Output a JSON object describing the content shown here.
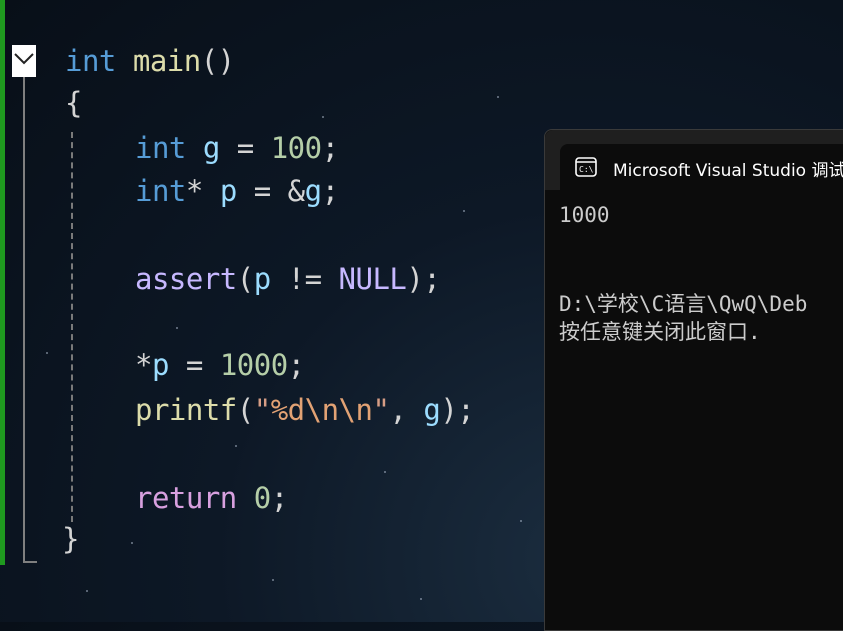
{
  "editor": {
    "lines": [
      {
        "tokens": [
          {
            "t": "int",
            "c": "kw"
          },
          {
            "t": " ",
            "c": "op"
          },
          {
            "t": "main",
            "c": "fn"
          },
          {
            "t": "()",
            "c": "pun"
          }
        ]
      },
      {
        "tokens": [
          {
            "t": "{",
            "c": "pun"
          }
        ]
      },
      {
        "tokens": [
          {
            "t": "int",
            "c": "kw"
          },
          {
            "t": " g",
            "c": "var"
          },
          {
            "t": " = ",
            "c": "op"
          },
          {
            "t": "100",
            "c": "num"
          },
          {
            "t": ";",
            "c": "pun"
          }
        ]
      },
      {
        "tokens": [
          {
            "t": "int",
            "c": "kw"
          },
          {
            "t": "* ",
            "c": "op"
          },
          {
            "t": "p",
            "c": "var"
          },
          {
            "t": " = &",
            "c": "op"
          },
          {
            "t": "g",
            "c": "var"
          },
          {
            "t": ";",
            "c": "pun"
          }
        ]
      },
      {
        "tokens": [
          {
            "t": "assert",
            "c": "mac"
          },
          {
            "t": "(",
            "c": "pun"
          },
          {
            "t": "p",
            "c": "var"
          },
          {
            "t": " != ",
            "c": "op"
          },
          {
            "t": "NULL",
            "c": "mac"
          },
          {
            "t": ");",
            "c": "pun"
          }
        ]
      },
      {
        "tokens": [
          {
            "t": "*",
            "c": "op"
          },
          {
            "t": "p",
            "c": "var"
          },
          {
            "t": " = ",
            "c": "op"
          },
          {
            "t": "1000",
            "c": "num"
          },
          {
            "t": ";",
            "c": "pun"
          }
        ]
      },
      {
        "tokens": [
          {
            "t": "printf",
            "c": "fn"
          },
          {
            "t": "(",
            "c": "pun"
          },
          {
            "t": "\"",
            "c": "str"
          },
          {
            "t": "%d",
            "c": "esc"
          },
          {
            "t": "\\n\\n",
            "c": "esc"
          },
          {
            "t": "\"",
            "c": "str"
          },
          {
            "t": ", ",
            "c": "pun"
          },
          {
            "t": "g",
            "c": "var"
          },
          {
            "t": ");",
            "c": "pun"
          }
        ]
      },
      {
        "tokens": [
          {
            "t": "return",
            "c": "ctl"
          },
          {
            "t": " ",
            "c": "op"
          },
          {
            "t": "0",
            "c": "num"
          },
          {
            "t": ";",
            "c": "pun"
          }
        ]
      },
      {
        "tokens": [
          {
            "t": "}",
            "c": "pun"
          }
        ]
      }
    ]
  },
  "console": {
    "title": "Microsoft Visual Studio 调试",
    "output_line1": "1000",
    "output_line2": "D:\\学校\\C语言\\QwQ\\Deb",
    "output_line3": "按任意键关闭此窗口. "
  },
  "colors": {
    "gutter_bar": "#1f9a1f",
    "keyword": "#569cd6",
    "function": "#dcdcaa",
    "variable": "#9cdcfe",
    "number": "#b5cea8",
    "macro": "#c7b8ff",
    "control": "#d8a0df"
  }
}
